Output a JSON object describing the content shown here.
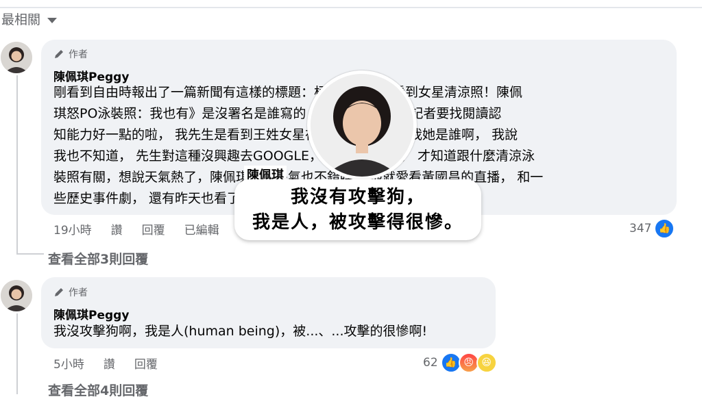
{
  "sort": {
    "label": "最相關"
  },
  "comments": [
    {
      "author_tag": "作者",
      "name": "陳佩琪Peggy",
      "text": "剛看到自由時報出了一篇新聞有這樣的標題：柯文哲滑新聞看到女星清涼照！陳佩\n琪怒PO泳裝照：我也有》是沒署名是誰寫的，但是建議一下找記者要找閱讀認\n知能力好一點的啦， 我先生是看到王姓女星在關鍵字中，才問我她是誰啊， 我說\n我也不知道， 先生對這種沒興趣去GOOGLE，是我剛去搜尋， 才知道跟什麼清涼泳\n裝照有關，想說天氣熱了，陳佩琪消消暑氣也不錯哩... 他就愛看黃國昌的直播， 和一\n些歷史事件劇， 還有昨天也看了一下， 他說想去探視他！",
      "time": "19小時",
      "like": "讚",
      "reply": "回覆",
      "edited": "已編輯",
      "reaction_count": "347",
      "view_replies": "查看全部3則回覆"
    },
    {
      "author_tag": "作者",
      "name": "陳佩琪Peggy",
      "text": "我沒攻擊狗啊，我是人(human being)，被...、...攻擊的很慘啊!",
      "time": "5小時",
      "like": "讚",
      "reply": "回覆",
      "reaction_count": "62",
      "view_replies": "查看全部4則回覆"
    }
  ],
  "overlay": {
    "name_label": "陳佩琪",
    "caption_line1": "我沒有攻擊狗，",
    "caption_line2": "我是人，被攻擊得很慘。"
  },
  "icons": [
    "pencil-icon",
    "like-icon",
    "angry-icon",
    "haha-icon",
    "chevron-down-icon"
  ],
  "colors": {
    "bubble": "#f0f2f5",
    "secondary_text": "#65676b",
    "like_blue": "#1877f2"
  }
}
